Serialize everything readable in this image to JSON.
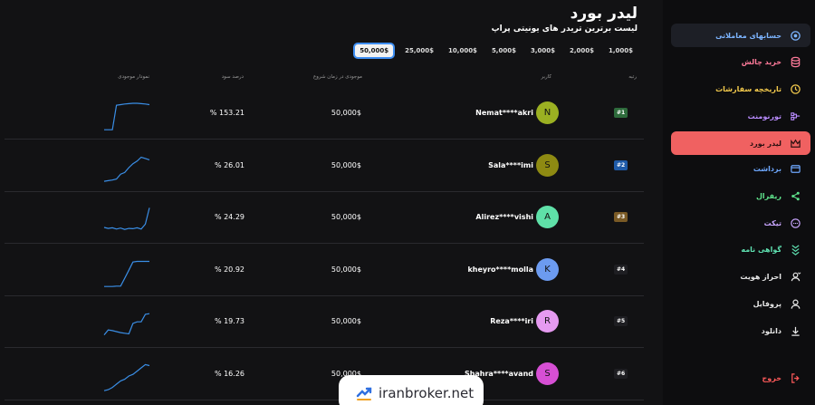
{
  "header": {
    "title": "لیدر بورد",
    "subtitle": "لیست برترین تریدر های یونیتی پراپ"
  },
  "amounts": [
    {
      "label": "1,000$",
      "selected": false
    },
    {
      "label": "2,000$",
      "selected": false
    },
    {
      "label": "3,000$",
      "selected": false
    },
    {
      "label": "5,000$",
      "selected": false
    },
    {
      "label": "10,000$",
      "selected": false
    },
    {
      "label": "25,000$",
      "selected": false
    },
    {
      "label": "50,000$",
      "selected": true
    }
  ],
  "table": {
    "columns": {
      "rank": "رتبه",
      "user": "کاربر",
      "start_balance": "موجودی در زمان شروع",
      "profit_pct": "درصد سود",
      "equity_chart": "نمودار موجودی"
    },
    "rows": [
      {
        "rank": "#1",
        "rank_color": "#2e6b3c",
        "avatar": "N",
        "avatar_color": "#9bb022",
        "user": "Nemat****akri",
        "balance": "50,000$",
        "profit": "153.21 %",
        "spark": [
          0.05,
          0.05,
          0.05,
          0.8,
          0.82,
          0.84,
          0.85,
          0.86,
          0.86,
          0.85,
          0.84,
          0.82
        ]
      },
      {
        "rank": "#2",
        "rank_color": "#1f5ba8",
        "avatar": "S",
        "avatar_color": "#8e8a12",
        "user": "Sala****imi",
        "balance": "50,000$",
        "profit": "26.01 %",
        "spark": [
          0.08,
          0.1,
          0.12,
          0.15,
          0.3,
          0.35,
          0.5,
          0.62,
          0.7,
          0.82,
          0.78,
          0.74
        ]
      },
      {
        "rank": "#3",
        "rank_color": "#7a5a25",
        "avatar": "A",
        "avatar_color": "#5fe0a8",
        "user": "Alirez****vishi",
        "balance": "50,000$",
        "profit": "24.29 %",
        "spark": [
          0.25,
          0.22,
          0.24,
          0.2,
          0.23,
          0.19,
          0.22,
          0.21,
          0.24,
          0.2,
          0.35,
          0.85
        ]
      },
      {
        "rank": "#4",
        "rank_color": "#1e1e22",
        "avatar": "K",
        "avatar_color": "#6c9bf0",
        "user": "kheyro****molla",
        "balance": "50,000$",
        "profit": "20.92 %",
        "spark": [
          0.05,
          0.05,
          0.05,
          0.06,
          0.06,
          0.3,
          0.55,
          0.8,
          0.82,
          0.82,
          0.82,
          0.82
        ]
      },
      {
        "rank": "#5",
        "rank_color": "#1e1e22",
        "avatar": "R",
        "avatar_color": "#e59af0",
        "user": "Reza****iri",
        "balance": "50,000$",
        "profit": "19.73 %",
        "spark": [
          0.15,
          0.3,
          0.28,
          0.25,
          0.22,
          0.2,
          0.18,
          0.5,
          0.55,
          0.55,
          0.78,
          0.8
        ]
      },
      {
        "rank": "#6",
        "rank_color": "#1e1e22",
        "avatar": "S",
        "avatar_color": "#d64fd4",
        "user": "Shahra****avand",
        "balance": "50,000$",
        "profit": "16.26 %",
        "spark": [
          0.05,
          0.08,
          0.15,
          0.25,
          0.35,
          0.4,
          0.5,
          0.55,
          0.65,
          0.75,
          0.85,
          0.82
        ]
      }
    ]
  },
  "sidebar": {
    "items": [
      {
        "label": "حسابهای معاملاتی",
        "icon": "layers-icon",
        "color": "#7cb4ff",
        "state": "selected"
      },
      {
        "label": "خرید چالش",
        "icon": "database-icon",
        "color": "#ff7a9a",
        "state": ""
      },
      {
        "label": "تاریخچه سفارشات",
        "icon": "history-icon",
        "color": "#f2c94c",
        "state": ""
      },
      {
        "label": "تورنومنت",
        "icon": "tournament-icon",
        "color": "#b98cff",
        "state": ""
      },
      {
        "label": "لیدر بورد",
        "icon": "crown-icon",
        "color": "#2b1010",
        "state": "active"
      },
      {
        "label": "برداشت",
        "icon": "wallet-icon",
        "color": "#6ea8ff",
        "state": ""
      },
      {
        "label": "ریفرال",
        "icon": "share-icon",
        "color": "#5ee08a",
        "state": ""
      },
      {
        "label": "تیکت",
        "icon": "chat-icon",
        "color": "#c9a6ff",
        "state": ""
      },
      {
        "label": "گواهی نامه",
        "icon": "certificate-icon",
        "color": "#5ee0b0",
        "state": ""
      },
      {
        "label": "احراز هویت",
        "icon": "id-icon",
        "color": "#e8e8e8",
        "state": ""
      },
      {
        "label": "پروفایل",
        "icon": "user-icon",
        "color": "#e8e8e8",
        "state": ""
      },
      {
        "label": "دانلود",
        "icon": "download-icon",
        "color": "#e8e8e8",
        "state": ""
      },
      {
        "label": "خروج",
        "icon": "logout-icon",
        "color": "#ff5a5a",
        "state": ""
      }
    ]
  },
  "watermark": {
    "text": "iranbroker.net"
  }
}
